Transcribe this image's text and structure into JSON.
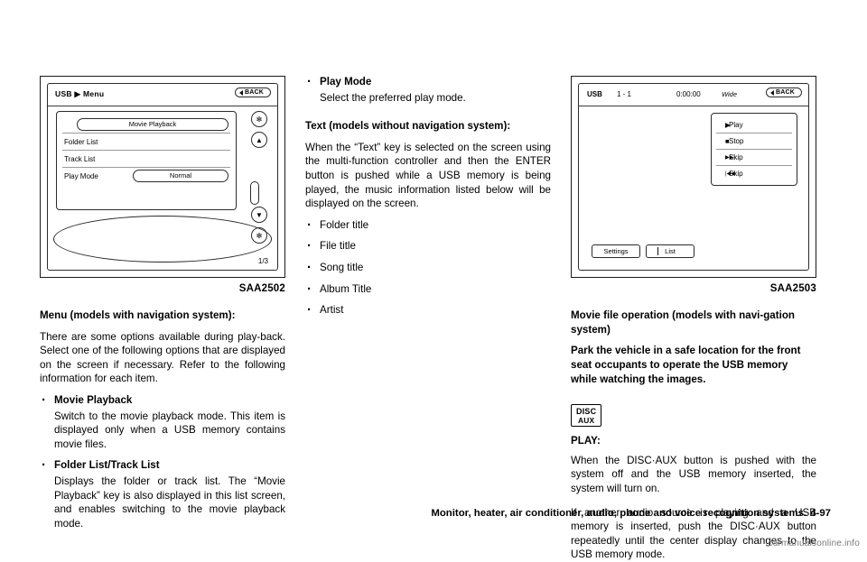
{
  "figure1": {
    "caption": "SAA2502",
    "screen": {
      "title": "USB ▶ Menu",
      "back_label": "BACK",
      "rows": [
        {
          "label": "",
          "pill": "Movie Playback"
        },
        {
          "label": "Folder List",
          "pill": ""
        },
        {
          "label": "Track List",
          "pill": ""
        },
        {
          "label": "Play Mode",
          "pill": "Normal"
        }
      ],
      "side_buttons": [
        "✻",
        "▲",
        "▼",
        "✻"
      ],
      "page_indicator": "1/3"
    }
  },
  "figure2": {
    "caption": "SAA2503",
    "screen": {
      "source": "USB",
      "track": "1 - 1",
      "time": "0:00:00",
      "mode": "Wide",
      "back_label": "BACK",
      "controls": [
        {
          "icon": "▶",
          "label": "Play"
        },
        {
          "icon": "■",
          "label": "Stop"
        },
        {
          "icon": "▶▶|",
          "label": "Skip"
        },
        {
          "icon": "|◀◀",
          "label": "Skip"
        }
      ],
      "buttons": [
        "Settings",
        "List"
      ]
    }
  },
  "column1": {
    "heading": "Menu (models with navigation system):",
    "paragraph": "There are some options available during play-back. Select one of the following options that are displayed on the screen if necessary. Refer to the following information for each item.",
    "bullets": [
      {
        "title": "Movie Playback",
        "desc": "Switch to the movie playback mode. This item is displayed only when a USB memory contains movie files."
      },
      {
        "title": "Folder List/Track List",
        "desc": "Displays the folder or track list. The “Movie Playback” key is also displayed in this list screen, and enables switching to the movie playback mode."
      }
    ]
  },
  "column2": {
    "top_bullet": {
      "title": "Play Mode",
      "desc": "Select the preferred play mode."
    },
    "heading": "Text (models without navigation system):",
    "paragraph": "When the “Text” key is selected on the screen using the multi-function controller and then the ENTER button is pushed while a USB memory is being played, the music information listed below will be displayed on the screen.",
    "items": [
      "Folder title",
      "File title",
      "Song title",
      "Album Title",
      "Artist"
    ]
  },
  "column3": {
    "heading": "Movie file operation (models with navi-gation system)",
    "subheading": "Park the vehicle in a safe location for the front seat occupants to operate the USB memory while watching the images.",
    "key_icon": {
      "line1": "DISC",
      "line2": "AUX"
    },
    "play_label": "PLAY:",
    "paragraphs": [
      "When the DISC·AUX button is pushed with the system off and the USB memory inserted, the system will turn on.",
      "If another audio source is playing and a USB memory is inserted, push the DISC·AUX button repeatedly until the center display changes to the USB memory mode."
    ]
  },
  "footer": {
    "text": "Monitor, heater, air conditioner, audio, phone and voice recognition systems",
    "separator": ".",
    "page": "4-97"
  },
  "watermark": "carmanualsonline.info"
}
